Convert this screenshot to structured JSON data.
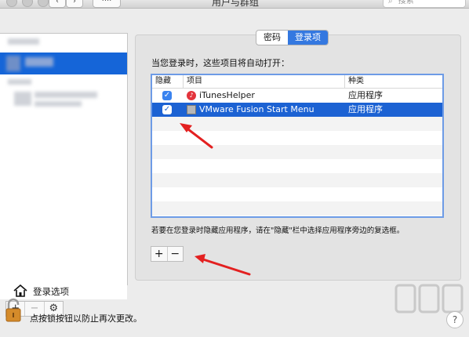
{
  "window": {
    "title": "用户与群组",
    "nav_back": "‹",
    "nav_forward": "›",
    "grid_button": "····",
    "search_placeholder": "搜索"
  },
  "sidebar": {
    "login_options_label": "登录选项",
    "tools": [
      "+",
      "−",
      "⚙"
    ]
  },
  "tabs": [
    {
      "label": "密码",
      "active": false
    },
    {
      "label": "登录项",
      "active": true
    }
  ],
  "main": {
    "description": "当您登录时，这些项目将自动打开：",
    "columns": {
      "hide": "隐藏",
      "item": "项目",
      "kind": "种类"
    },
    "rows": [
      {
        "checked": "✓",
        "icon": "itunes-icon",
        "name": "iTunesHelper",
        "kind": "应用程序",
        "selected": false
      },
      {
        "checked": "✓",
        "icon": "vmware-icon",
        "name": "VMware Fusion Start Menu",
        "kind": "应用程序",
        "selected": true
      }
    ],
    "hint": "若要在您登录时隐藏应用程序，请在\"隐藏\"栏中选择应用程序旁边的复选框。",
    "add_label": "+",
    "remove_label": "−"
  },
  "footer": {
    "lock_text": "点按锁按钮以防止再次更改。",
    "help": "?"
  },
  "colors": {
    "selection": "#1c62d3",
    "accent": "#3478e0",
    "annotation_arrow": "#e32020"
  }
}
